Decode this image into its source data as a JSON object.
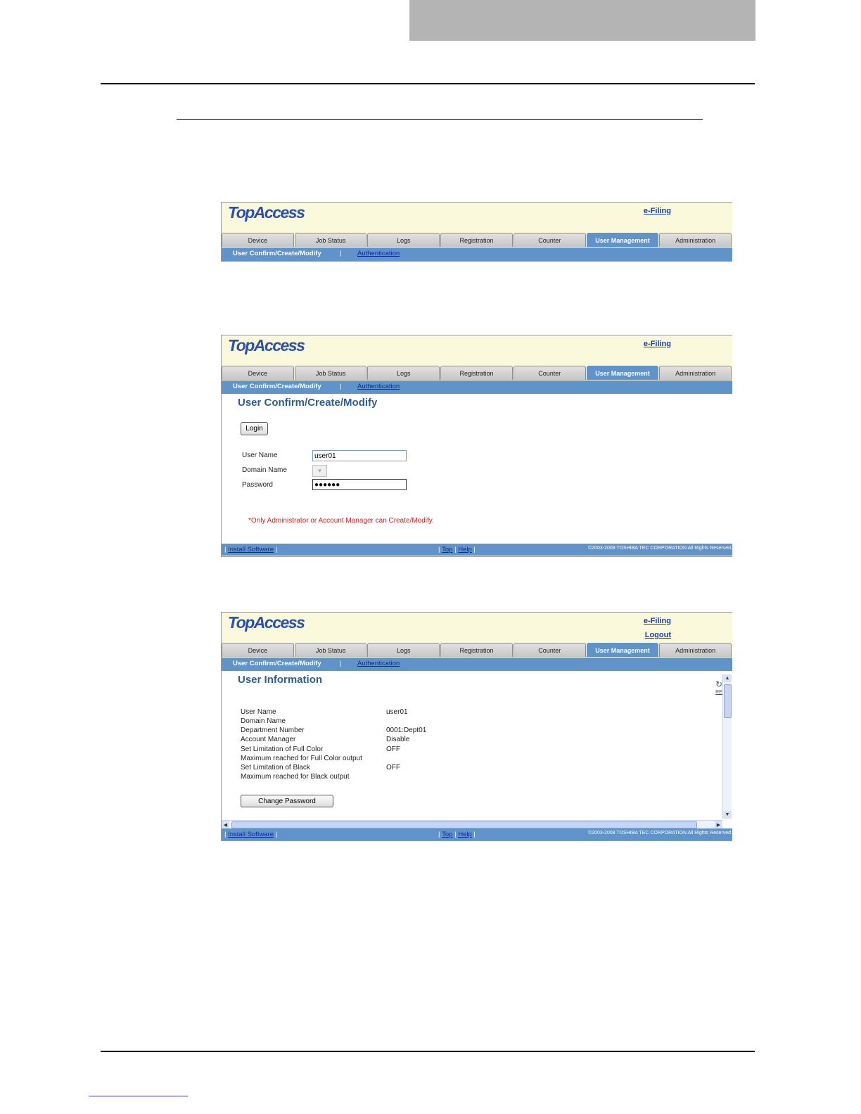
{
  "app": {
    "logo": "TopAccess",
    "efiling_link": "e-Filing",
    "logout_link": "Logout",
    "tabs": [
      "Device",
      "Job Status",
      "Logs",
      "Registration",
      "Counter",
      "User Management",
      "Administration"
    ],
    "active_tab": "User Management",
    "subnav": {
      "current": "User Confirm/Create/Modify",
      "separator": "|",
      "link": "Authentication"
    },
    "footer": {
      "install": "Install Software",
      "top": "Top",
      "help": "Help",
      "pipe": "|",
      "copyright": "©2003-2008 TOSHIBA TEC CORPORATION All Rights Reserved."
    }
  },
  "login_screen": {
    "title": "User Confirm/Create/Modify",
    "login_button": "Login",
    "fields": {
      "user_name_label": "User Name",
      "user_name_value": "user01",
      "domain_name_label": "Domain Name",
      "password_label": "Password",
      "password_value": "●●●●●●"
    },
    "note": "*Only Administrator or Account Manager can Create/Modify."
  },
  "info_screen": {
    "title": "User Information",
    "refresh_label": "RE",
    "rows": [
      {
        "label": "User Name",
        "value": "user01"
      },
      {
        "label": "Domain Name",
        "value": ""
      },
      {
        "label": "Department Number",
        "value": "0001:Dept01"
      },
      {
        "label": "Account Manager",
        "value": "Disable"
      },
      {
        "label": "Set Limitation of Full Color",
        "value": "OFF"
      },
      {
        "label": "Maximum reached for Full Color output",
        "value": ""
      },
      {
        "label": "Set Limitation of Black",
        "value": "OFF"
      },
      {
        "label": "Maximum reached for Black output",
        "value": ""
      }
    ],
    "change_password_button": "Change Password"
  }
}
